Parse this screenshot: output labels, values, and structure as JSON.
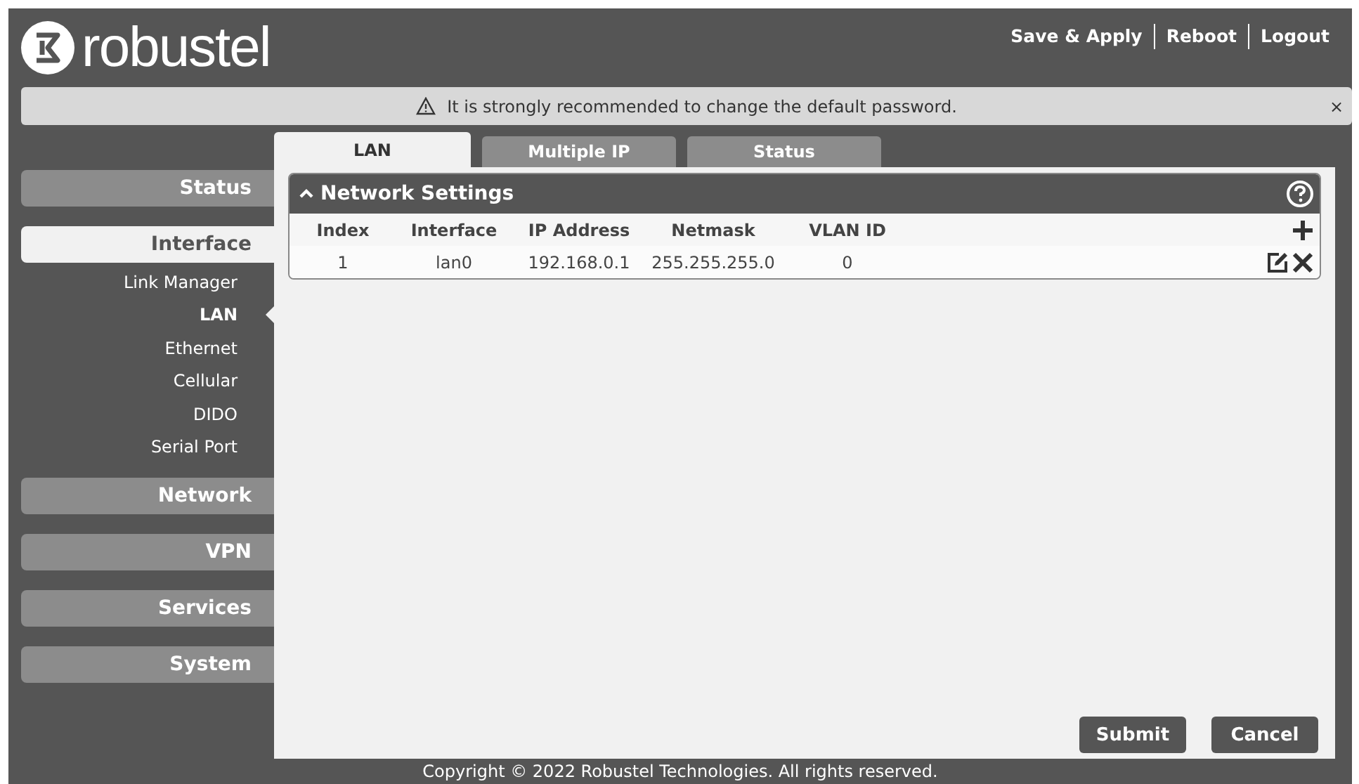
{
  "brand": {
    "logo_text": "robustel"
  },
  "header_links": [
    "Save & Apply",
    "Reboot",
    "Logout"
  ],
  "banner": {
    "message": "It is strongly recommended to change the default password.",
    "close": "×"
  },
  "sidebar": {
    "items": [
      {
        "label": "Status",
        "selected": false
      },
      {
        "label": "Interface",
        "selected": true,
        "children": [
          {
            "label": "Link Manager",
            "selected": false
          },
          {
            "label": "LAN",
            "selected": true
          },
          {
            "label": "Ethernet",
            "selected": false
          },
          {
            "label": "Cellular",
            "selected": false
          },
          {
            "label": "DIDO",
            "selected": false
          },
          {
            "label": "Serial Port",
            "selected": false
          }
        ]
      },
      {
        "label": "Network",
        "selected": false
      },
      {
        "label": "VPN",
        "selected": false
      },
      {
        "label": "Services",
        "selected": false
      },
      {
        "label": "System",
        "selected": false
      }
    ]
  },
  "tabs": [
    {
      "label": "LAN",
      "selected": true
    },
    {
      "label": "Multiple IP",
      "selected": false
    },
    {
      "label": "Status",
      "selected": false
    }
  ],
  "section": {
    "title": "Network Settings",
    "expanded": true,
    "table": {
      "columns": [
        "Index",
        "Interface",
        "IP Address",
        "Netmask",
        "VLAN ID"
      ],
      "rows": [
        [
          "1",
          "lan0",
          "192.168.0.1",
          "255.255.255.0",
          "0"
        ]
      ]
    }
  },
  "buttons": [
    "Submit",
    "Cancel"
  ],
  "footer": "Copyright © 2022 Robustel Technologies. All rights reserved."
}
